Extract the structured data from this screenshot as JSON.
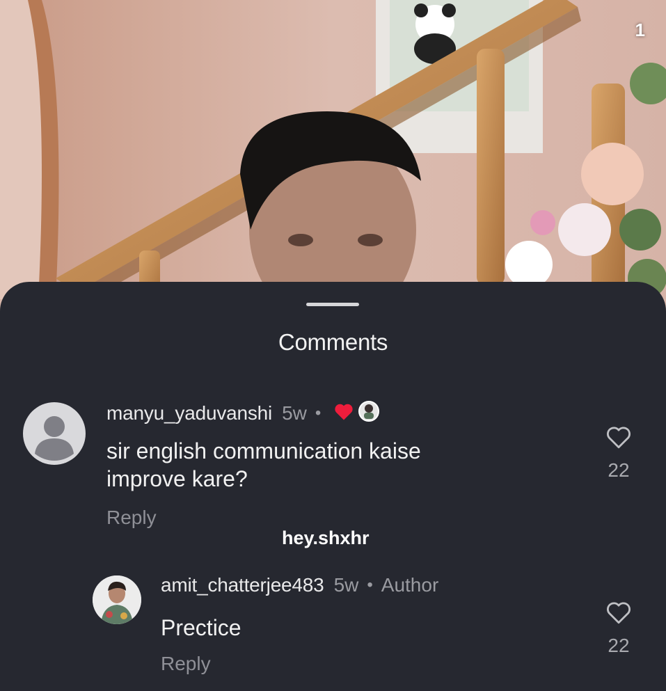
{
  "video": {
    "corner_badge": "1"
  },
  "sheet": {
    "title": "Comments",
    "watermark": "hey.shxhr"
  },
  "comments": [
    {
      "username": "manyu_yaduvanshi",
      "time": "5w",
      "avatar": "default-person-icon",
      "liked_by_author": true,
      "text_lines": [
        "sir english communication kaise",
        "improve kare?"
      ],
      "reply_label": "Reply",
      "like_count": "22"
    },
    {
      "username": "amit_chatterjee483",
      "time": "5w",
      "badge": "Author",
      "avatar": "author-photo",
      "text_lines": [
        "Prectice"
      ],
      "reply_label": "Reply",
      "like_count": "22"
    }
  ],
  "colors": {
    "sheet_bg": "#262830",
    "heart_red": "#ee1d3c",
    "muted": "#9a9ba1"
  }
}
